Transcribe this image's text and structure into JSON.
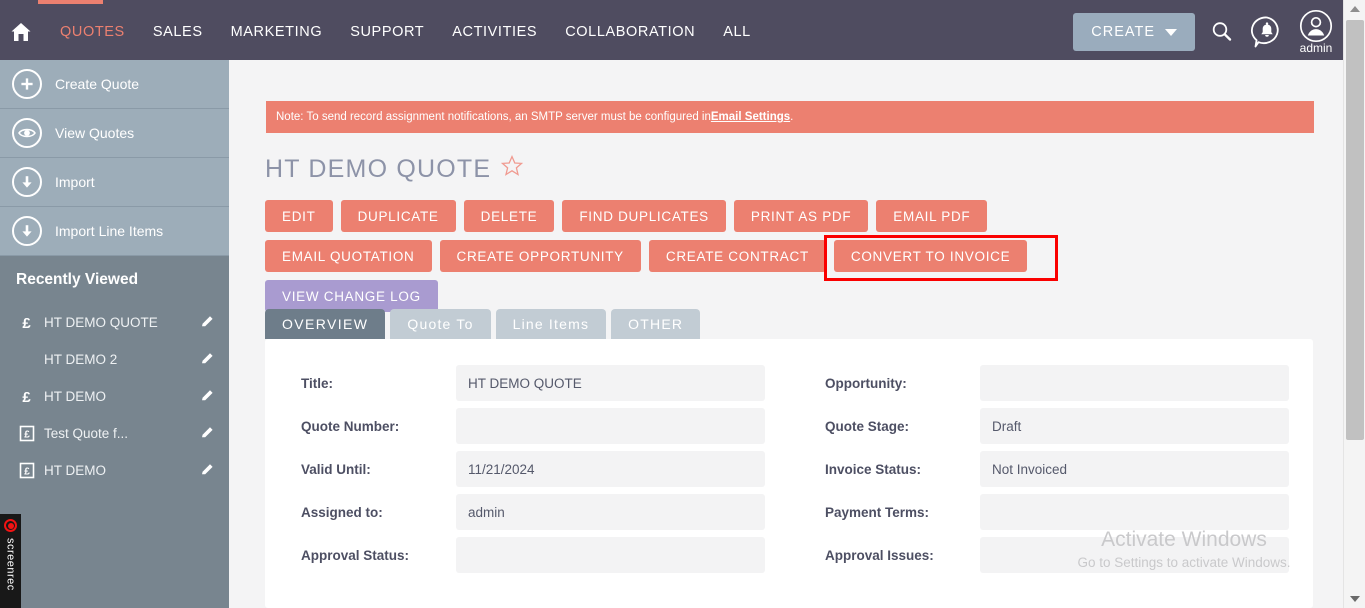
{
  "topnav": {
    "home_icon": "home-icon",
    "items": [
      {
        "label": "QUOTES",
        "active": true
      },
      {
        "label": "SALES",
        "active": false
      },
      {
        "label": "MARKETING",
        "active": false
      },
      {
        "label": "SUPPORT",
        "active": false
      },
      {
        "label": "ACTIVITIES",
        "active": false
      },
      {
        "label": "COLLABORATION",
        "active": false
      },
      {
        "label": "ALL",
        "active": false
      }
    ],
    "create_label": "CREATE",
    "search_icon": "search-icon",
    "notification_icon": "notification-bell-icon",
    "avatar_icon": "user-avatar-icon",
    "avatar_label": "admin",
    "accent_color": "#ec8070",
    "bar_color": "#4f4c60"
  },
  "sidebar": {
    "actions": [
      {
        "label": "Create Quote",
        "icon": "plus-circle-icon"
      },
      {
        "label": "View Quotes",
        "icon": "eye-circle-icon"
      },
      {
        "label": "Import",
        "icon": "download-circle-icon"
      },
      {
        "label": "Import Line Items",
        "icon": "download-circle-icon"
      }
    ],
    "recently_viewed_title": "Recently Viewed",
    "recent_items": [
      {
        "label": "HT DEMO QUOTE",
        "icon": "pound-sign-icon",
        "edit_icon": "pencil-icon"
      },
      {
        "label": "HT DEMO 2",
        "icon": "none",
        "edit_icon": "pencil-icon"
      },
      {
        "label": "HT DEMO",
        "icon": "pound-sign-icon",
        "edit_icon": "pencil-icon"
      },
      {
        "label": "Test Quote f...",
        "icon": "invoice-pound-icon",
        "edit_icon": "pencil-icon"
      },
      {
        "label": "HT DEMO",
        "icon": "invoice-pound-icon",
        "edit_icon": "pencil-icon"
      }
    ],
    "collapse_icon": "collapse-left-icon"
  },
  "notice": {
    "text_before": "Note: To send record assignment notifications, an SMTP server must be configured in ",
    "link": "Email Settings",
    "text_after": ".",
    "background": "#ec8070"
  },
  "record": {
    "title": "HT DEMO QUOTE",
    "favorite_icon": "star-outline-icon"
  },
  "actions": {
    "row1": [
      "EDIT",
      "DUPLICATE",
      "DELETE",
      "FIND DUPLICATES",
      "PRINT AS PDF",
      "EMAIL PDF"
    ],
    "row2": [
      "EMAIL QUOTATION",
      "CREATE OPPORTUNITY",
      "CREATE CONTRACT",
      "CONVERT TO INVOICE"
    ],
    "row3": [
      "VIEW CHANGE LOG"
    ],
    "highlighted": "CONVERT TO INVOICE",
    "highlight_color": "#fa0000",
    "button_color": "#ec8070",
    "changelog_color": "#a99bd0"
  },
  "tabs": [
    {
      "label": "OVERVIEW",
      "active": true
    },
    {
      "label": "Quote To",
      "active": false
    },
    {
      "label": "Line Items",
      "active": false
    },
    {
      "label": "OTHER",
      "active": false
    }
  ],
  "overview": {
    "left_fields": [
      {
        "label": "Title:",
        "value": "HT DEMO QUOTE"
      },
      {
        "label": "Quote Number:",
        "value": ""
      },
      {
        "label": "Valid Until:",
        "value": "11/21/2024"
      },
      {
        "label": "Assigned to:",
        "value": "admin"
      },
      {
        "label": "Approval Status:",
        "value": ""
      }
    ],
    "right_fields": [
      {
        "label": "Opportunity:",
        "value": ""
      },
      {
        "label": "Quote Stage:",
        "value": "Draft"
      },
      {
        "label": "Invoice Status:",
        "value": "Not Invoiced"
      },
      {
        "label": "Payment Terms:",
        "value": ""
      },
      {
        "label": "Approval Issues:",
        "value": ""
      }
    ]
  },
  "watermark": {
    "line1": "Activate Windows",
    "line2": "Go to Settings to activate Windows."
  },
  "screen_recorder": {
    "label": "screenrec",
    "record_icon": "record-dot-icon"
  },
  "scrollbar": {
    "up_icon": "scroll-up-arrow-icon",
    "down_icon": "scroll-down-arrow-icon"
  }
}
